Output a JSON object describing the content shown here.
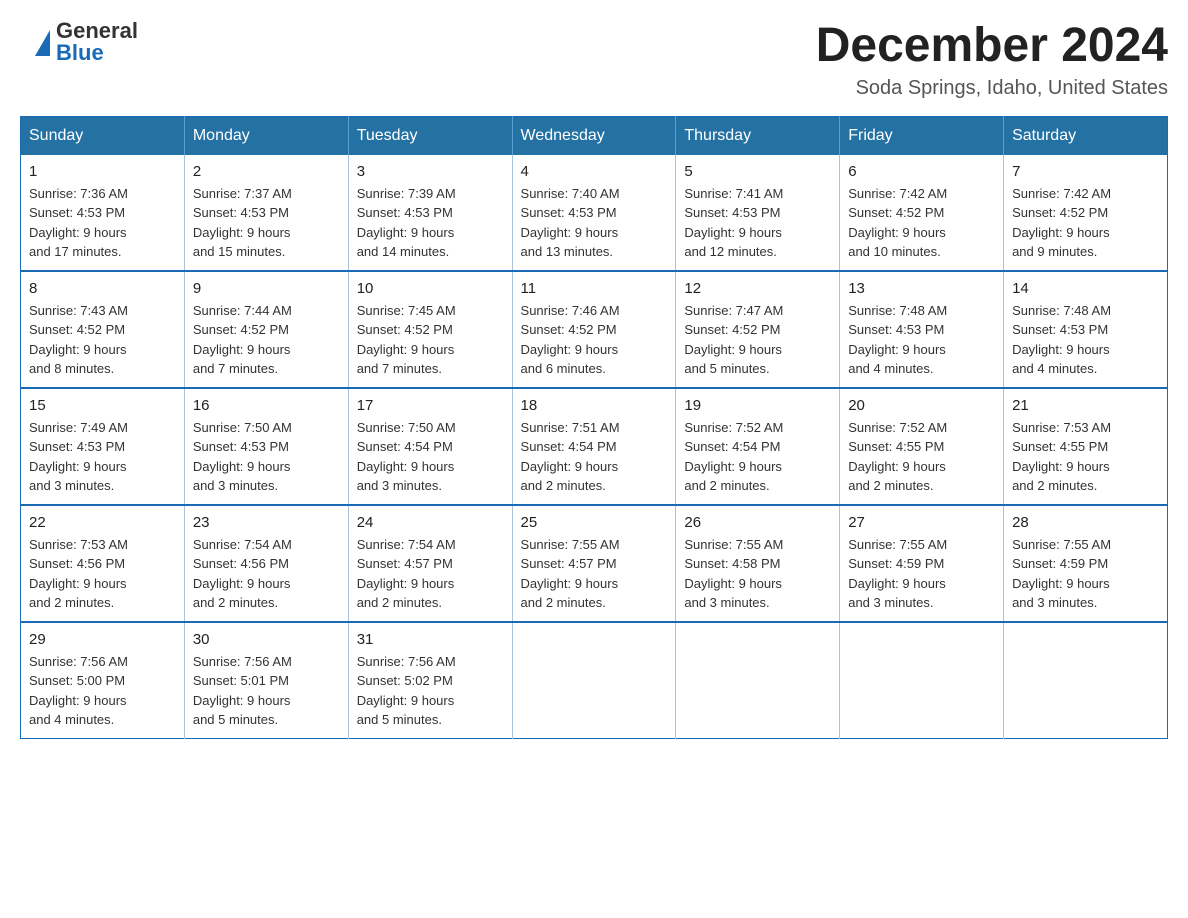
{
  "header": {
    "logo_general": "General",
    "logo_blue": "Blue",
    "month_title": "December 2024",
    "location": "Soda Springs, Idaho, United States"
  },
  "calendar": {
    "days_of_week": [
      "Sunday",
      "Monday",
      "Tuesday",
      "Wednesday",
      "Thursday",
      "Friday",
      "Saturday"
    ],
    "weeks": [
      [
        {
          "day": "1",
          "sunrise": "7:36 AM",
          "sunset": "4:53 PM",
          "daylight": "9 hours and 17 minutes."
        },
        {
          "day": "2",
          "sunrise": "7:37 AM",
          "sunset": "4:53 PM",
          "daylight": "9 hours and 15 minutes."
        },
        {
          "day": "3",
          "sunrise": "7:39 AM",
          "sunset": "4:53 PM",
          "daylight": "9 hours and 14 minutes."
        },
        {
          "day": "4",
          "sunrise": "7:40 AM",
          "sunset": "4:53 PM",
          "daylight": "9 hours and 13 minutes."
        },
        {
          "day": "5",
          "sunrise": "7:41 AM",
          "sunset": "4:53 PM",
          "daylight": "9 hours and 12 minutes."
        },
        {
          "day": "6",
          "sunrise": "7:42 AM",
          "sunset": "4:52 PM",
          "daylight": "9 hours and 10 minutes."
        },
        {
          "day": "7",
          "sunrise": "7:42 AM",
          "sunset": "4:52 PM",
          "daylight": "9 hours and 9 minutes."
        }
      ],
      [
        {
          "day": "8",
          "sunrise": "7:43 AM",
          "sunset": "4:52 PM",
          "daylight": "9 hours and 8 minutes."
        },
        {
          "day": "9",
          "sunrise": "7:44 AM",
          "sunset": "4:52 PM",
          "daylight": "9 hours and 7 minutes."
        },
        {
          "day": "10",
          "sunrise": "7:45 AM",
          "sunset": "4:52 PM",
          "daylight": "9 hours and 7 minutes."
        },
        {
          "day": "11",
          "sunrise": "7:46 AM",
          "sunset": "4:52 PM",
          "daylight": "9 hours and 6 minutes."
        },
        {
          "day": "12",
          "sunrise": "7:47 AM",
          "sunset": "4:52 PM",
          "daylight": "9 hours and 5 minutes."
        },
        {
          "day": "13",
          "sunrise": "7:48 AM",
          "sunset": "4:53 PM",
          "daylight": "9 hours and 4 minutes."
        },
        {
          "day": "14",
          "sunrise": "7:48 AM",
          "sunset": "4:53 PM",
          "daylight": "9 hours and 4 minutes."
        }
      ],
      [
        {
          "day": "15",
          "sunrise": "7:49 AM",
          "sunset": "4:53 PM",
          "daylight": "9 hours and 3 minutes."
        },
        {
          "day": "16",
          "sunrise": "7:50 AM",
          "sunset": "4:53 PM",
          "daylight": "9 hours and 3 minutes."
        },
        {
          "day": "17",
          "sunrise": "7:50 AM",
          "sunset": "4:54 PM",
          "daylight": "9 hours and 3 minutes."
        },
        {
          "day": "18",
          "sunrise": "7:51 AM",
          "sunset": "4:54 PM",
          "daylight": "9 hours and 2 minutes."
        },
        {
          "day": "19",
          "sunrise": "7:52 AM",
          "sunset": "4:54 PM",
          "daylight": "9 hours and 2 minutes."
        },
        {
          "day": "20",
          "sunrise": "7:52 AM",
          "sunset": "4:55 PM",
          "daylight": "9 hours and 2 minutes."
        },
        {
          "day": "21",
          "sunrise": "7:53 AM",
          "sunset": "4:55 PM",
          "daylight": "9 hours and 2 minutes."
        }
      ],
      [
        {
          "day": "22",
          "sunrise": "7:53 AM",
          "sunset": "4:56 PM",
          "daylight": "9 hours and 2 minutes."
        },
        {
          "day": "23",
          "sunrise": "7:54 AM",
          "sunset": "4:56 PM",
          "daylight": "9 hours and 2 minutes."
        },
        {
          "day": "24",
          "sunrise": "7:54 AM",
          "sunset": "4:57 PM",
          "daylight": "9 hours and 2 minutes."
        },
        {
          "day": "25",
          "sunrise": "7:55 AM",
          "sunset": "4:57 PM",
          "daylight": "9 hours and 2 minutes."
        },
        {
          "day": "26",
          "sunrise": "7:55 AM",
          "sunset": "4:58 PM",
          "daylight": "9 hours and 3 minutes."
        },
        {
          "day": "27",
          "sunrise": "7:55 AM",
          "sunset": "4:59 PM",
          "daylight": "9 hours and 3 minutes."
        },
        {
          "day": "28",
          "sunrise": "7:55 AM",
          "sunset": "4:59 PM",
          "daylight": "9 hours and 3 minutes."
        }
      ],
      [
        {
          "day": "29",
          "sunrise": "7:56 AM",
          "sunset": "5:00 PM",
          "daylight": "9 hours and 4 minutes."
        },
        {
          "day": "30",
          "sunrise": "7:56 AM",
          "sunset": "5:01 PM",
          "daylight": "9 hours and 5 minutes."
        },
        {
          "day": "31",
          "sunrise": "7:56 AM",
          "sunset": "5:02 PM",
          "daylight": "9 hours and 5 minutes."
        },
        null,
        null,
        null,
        null
      ]
    ]
  }
}
